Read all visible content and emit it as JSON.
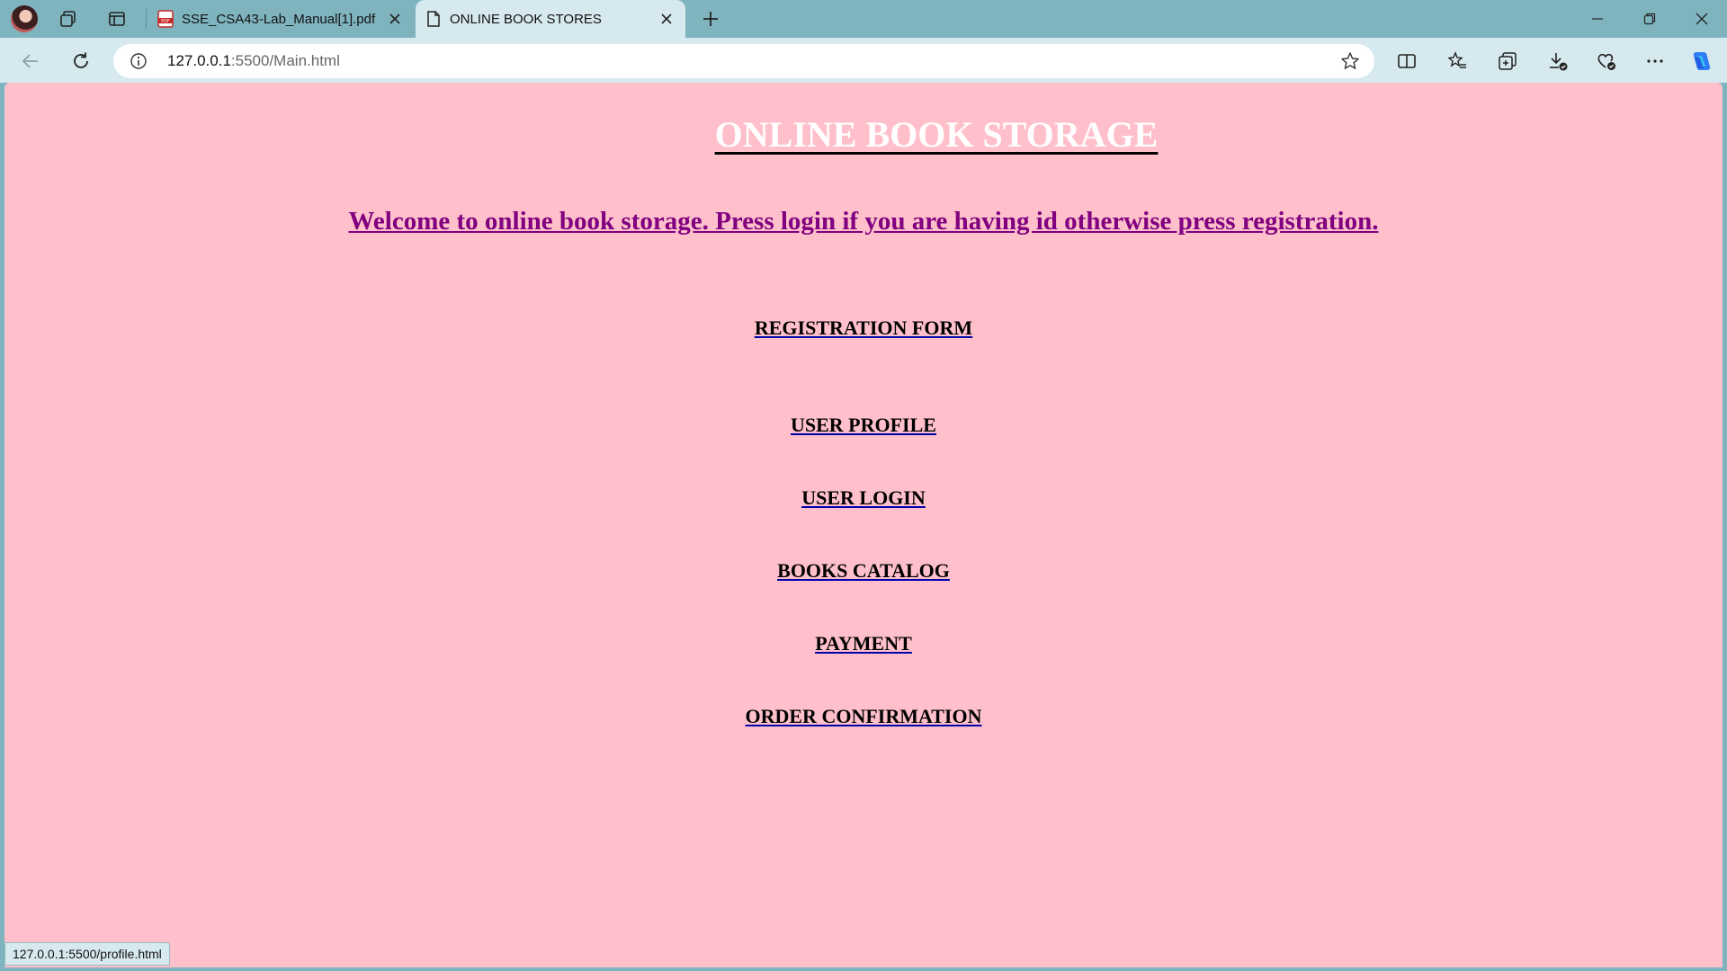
{
  "tabs": [
    {
      "title": "SSE_CSA43-Lab_Manual[1].pdf",
      "icon": "pdf-icon"
    },
    {
      "title": "ONLINE BOOK STORES",
      "icon": "page-icon",
      "active": true
    }
  ],
  "address_bar": {
    "host": "127.0.0.1",
    "rest": ":5500/Main.html"
  },
  "page": {
    "background": "#ffc0cb",
    "title": "ONLINE BOOK STORAGE",
    "welcome": "Welcome to online book storage. Press login if you are having id otherwise press registration.",
    "links": [
      "REGISTRATION FORM",
      "USER PROFILE",
      "USER LOGIN",
      "BOOKS CATALOG",
      "PAYMENT",
      "ORDER CONFIRMATION"
    ]
  },
  "status_bar": {
    "hover_url": "127.0.0.1:5500/profile.html"
  },
  "colors": {
    "chrome": "#7fb4bf",
    "toolbar": "#d6e9ee",
    "welcome_text": "#800080",
    "title_text": "#ffffff"
  }
}
